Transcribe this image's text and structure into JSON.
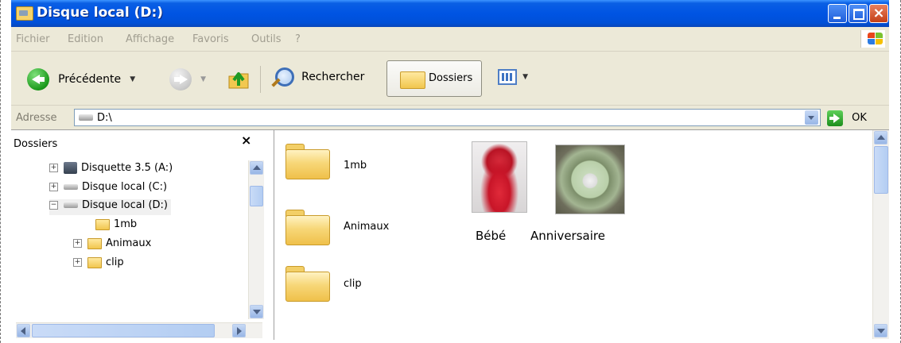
{
  "window": {
    "title": "Disque local (D:)"
  },
  "menu": [
    "Fichier",
    "Edition",
    "Affichage",
    "Favoris",
    "Outils",
    "?"
  ],
  "toolbar": {
    "back_label": "Précédente",
    "search_label": "Rechercher",
    "folders_label": "Dossiers"
  },
  "address": {
    "label": "Adresse",
    "value": "D:\\",
    "go_label": "OK"
  },
  "folder_pane": {
    "title": "Dossiers",
    "close_symbol": "×",
    "tree": [
      {
        "label": "Disquette 3.5 (A:)",
        "icon": "floppy-icon",
        "expander": "+"
      },
      {
        "label": "Disque local (C:)",
        "icon": "drive-icon",
        "expander": "+"
      },
      {
        "label": "Disque local (D:)",
        "icon": "drive-icon",
        "expander": "−"
      },
      {
        "label": "1mb",
        "icon": "folder-icon",
        "expander": ""
      },
      {
        "label": "Animaux",
        "icon": "folder-icon",
        "expander": "+"
      },
      {
        "label": "clip",
        "icon": "folder-icon",
        "expander": "+"
      }
    ]
  },
  "content": {
    "folders": [
      {
        "name": "1mb"
      },
      {
        "name": "Animaux"
      },
      {
        "name": "clip"
      }
    ],
    "images": [
      {
        "name": "Bébé"
      },
      {
        "name": "Anniversaire"
      }
    ]
  },
  "colors": {
    "titlebar": "#0054e3",
    "chrome": "#ece9d8"
  }
}
